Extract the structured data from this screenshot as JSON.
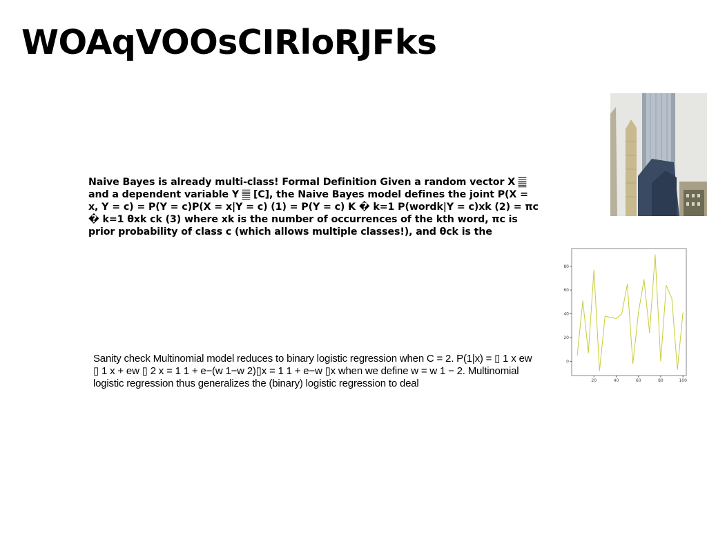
{
  "slide": {
    "title": "WOAqVOOsCIRloRJFks",
    "paragraph_bold": "Naive Bayes is already multi-class! Formal Definition Given a random vector X 𝄛 and a dependent variable Y 𝄛 [C], the Naive Bayes model defines the joint P(X = x, Y = c) = P(Y = c)P(X = x|Y = c) (1) = P(Y = c) K � k=1 P(wordk|Y = c)xk (2) = πc � k=1 θxk ck (3) where xk is the number of occurrences of the kth word, πc is prior probability of class c (which allows multiple classes!), and θck is the",
    "paragraph_plain": "Sanity check Multinomial model reduces to binary logistic regression when C = 2. P(1|x) = ▯ 1 x ew ▯ 1 x + ew ▯ 2 x = 1 1 + e−(w 1−w 2)▯x = 1 1 + e−w ▯x when we define w = w 1 − 2. Multinomial logistic regression thus generalizes the (binary) logistic regression to deal"
  },
  "images": {
    "photo_icon": "skyscraper-photo"
  },
  "chart_data": {
    "type": "line",
    "title": "",
    "xlabel": "",
    "ylabel": "",
    "x": [
      5,
      10,
      15,
      20,
      25,
      30,
      35,
      40,
      45,
      50,
      55,
      60,
      65,
      70,
      75,
      80,
      85,
      90,
      95,
      100
    ],
    "series": [
      {
        "values": [
          5,
          51,
          7,
          77,
          -8,
          38,
          37,
          36,
          40,
          65,
          -2,
          41,
          69,
          24,
          90,
          0,
          64,
          53,
          -7,
          41
        ]
      }
    ],
    "xticks": [
      "20",
      "40",
      "60",
      "80",
      "100"
    ],
    "yticks": [
      "0",
      "20",
      "40",
      "60",
      "80"
    ],
    "xlim": [
      0,
      103
    ],
    "ylim": [
      -12,
      95
    ],
    "grid": false,
    "line_color": "#c8cc3a"
  }
}
